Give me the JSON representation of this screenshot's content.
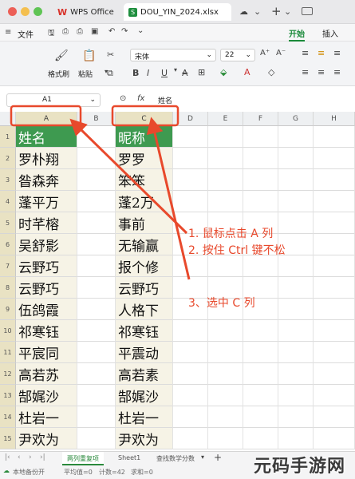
{
  "window": {
    "tabs": [
      {
        "label": "WPS Office"
      },
      {
        "label": "DOU_YIN_2024.xlsx"
      }
    ],
    "dot_colors": [
      "#ec5f57",
      "#f4bf4f",
      "#5fc454"
    ]
  },
  "menubar": {
    "file_label": "文件",
    "tabs": [
      {
        "label": "开始"
      },
      {
        "label": "插入"
      }
    ]
  },
  "ribbon": {
    "format_painter_label": "格式刷",
    "paste_label": "粘贴",
    "font_name": "宋体",
    "font_size": "22"
  },
  "formula_bar": {
    "cell_ref": "A1",
    "fx_label": "fx",
    "content": "姓名"
  },
  "grid": {
    "column_headers": [
      "A",
      "B",
      "C",
      "D",
      "E",
      "F",
      "G",
      "H"
    ],
    "rows": [
      {
        "num": "1",
        "a": "姓名",
        "c": "昵称"
      },
      {
        "num": "2",
        "a": "罗朴翔",
        "c": "罗罗"
      },
      {
        "num": "3",
        "a": "昝森奔",
        "c": "笨笨"
      },
      {
        "num": "4",
        "a": "蓬平万",
        "c": "蓬2万"
      },
      {
        "num": "5",
        "a": "时芊榕",
        "c": "事前"
      },
      {
        "num": "6",
        "a": "吴舒影",
        "c": "无输赢"
      },
      {
        "num": "7",
        "a": "云野巧",
        "c": "报个修"
      },
      {
        "num": "8",
        "a": "云野巧",
        "c": "云野巧"
      },
      {
        "num": "9",
        "a": "伍鸽霞",
        "c": "人格下"
      },
      {
        "num": "10",
        "a": "祁寒钰",
        "c": "祁寒钰"
      },
      {
        "num": "11",
        "a": "平宸同",
        "c": "平震动"
      },
      {
        "num": "12",
        "a": "高若苏",
        "c": "高若素"
      },
      {
        "num": "13",
        "a": "郜娓沙",
        "c": "郜娓沙"
      },
      {
        "num": "14",
        "a": "杜岩一",
        "c": "杜岩一"
      },
      {
        "num": "15",
        "a": "尹欢为",
        "c": "尹欢为"
      }
    ]
  },
  "annotations": {
    "step1": "1. 鼠标点击 A 列",
    "step2": "2. 按住 Ctrl 键不松",
    "step3": "3、选中 C 列",
    "color": "#e8492c"
  },
  "sheet_tabs": [
    {
      "label": "两列重复项"
    },
    {
      "label": "Sheet1"
    },
    {
      "label": "查找数学分数"
    }
  ],
  "statusbar": {
    "backup": "本地备份开",
    "average": "平均值=0",
    "count": "计数=42",
    "sum": "求和=0"
  },
  "watermark": {
    "text": "元码手游网"
  }
}
